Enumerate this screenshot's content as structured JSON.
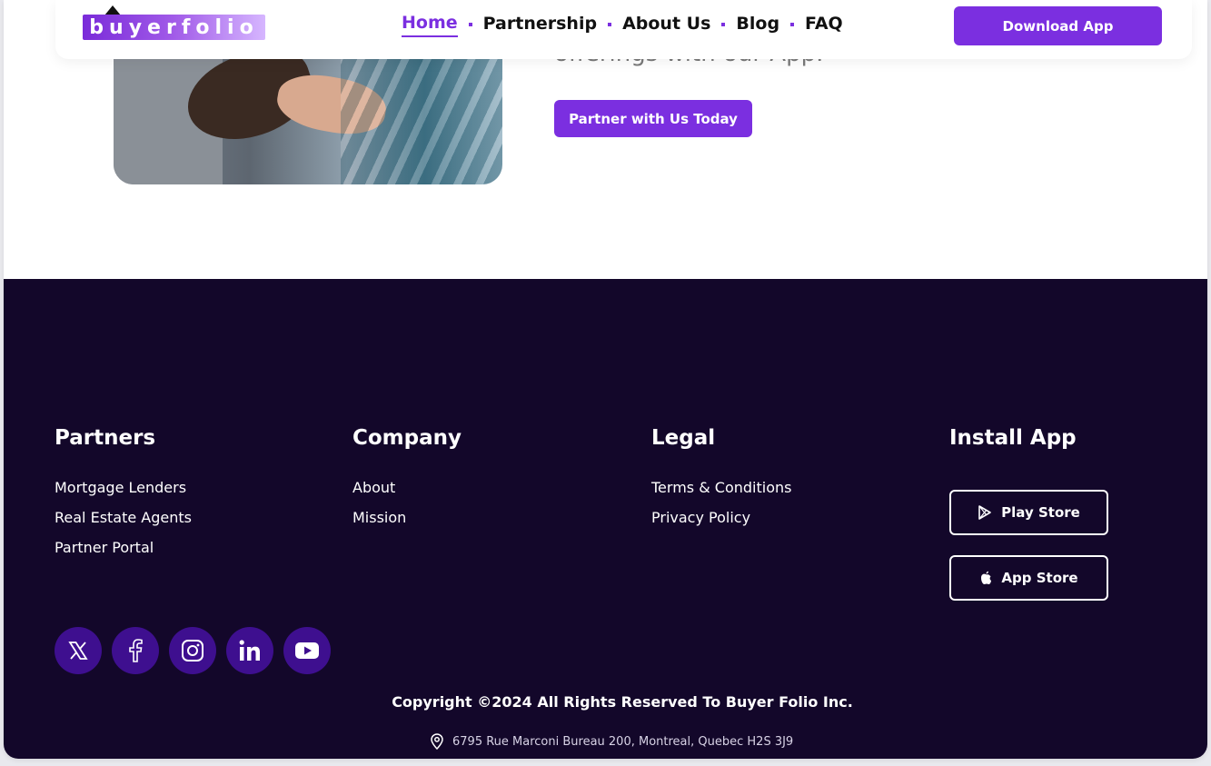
{
  "header": {
    "logo_text": "buyerfolio",
    "nav": [
      {
        "label": "Home",
        "active": true
      },
      {
        "label": "Partnership",
        "active": false
      },
      {
        "label": "About Us",
        "active": false
      },
      {
        "label": "Blog",
        "active": false
      },
      {
        "label": "FAQ",
        "active": false
      }
    ],
    "download_label": "Download App"
  },
  "hero": {
    "text_fragment": "offerings with our App.",
    "cta_label": "Partner with Us Today"
  },
  "footer": {
    "columns": [
      {
        "title": "Partners",
        "links": [
          "Mortgage Lenders",
          "Real Estate Agents",
          "Partner Portal"
        ]
      },
      {
        "title": "Company",
        "links": [
          "About",
          "Mission"
        ]
      },
      {
        "title": "Legal",
        "links": [
          "Terms & Conditions",
          "Privacy Policy"
        ]
      }
    ],
    "install": {
      "title": "Install App",
      "play_store": "Play Store",
      "app_store": "App Store"
    },
    "socials": [
      "x-icon",
      "facebook-icon",
      "instagram-icon",
      "linkedin-icon",
      "youtube-icon"
    ],
    "copyright": "Copyright ©2024 All Rights Reserved  To Buyer Folio Inc.",
    "address": "6795 Rue Marconi Bureau 200, Montreal, Quebec H2S 3J9"
  },
  "colors": {
    "accent": "#7b2fe0",
    "footer_bg": "#13072a",
    "social_bg": "#3e0f8f"
  }
}
